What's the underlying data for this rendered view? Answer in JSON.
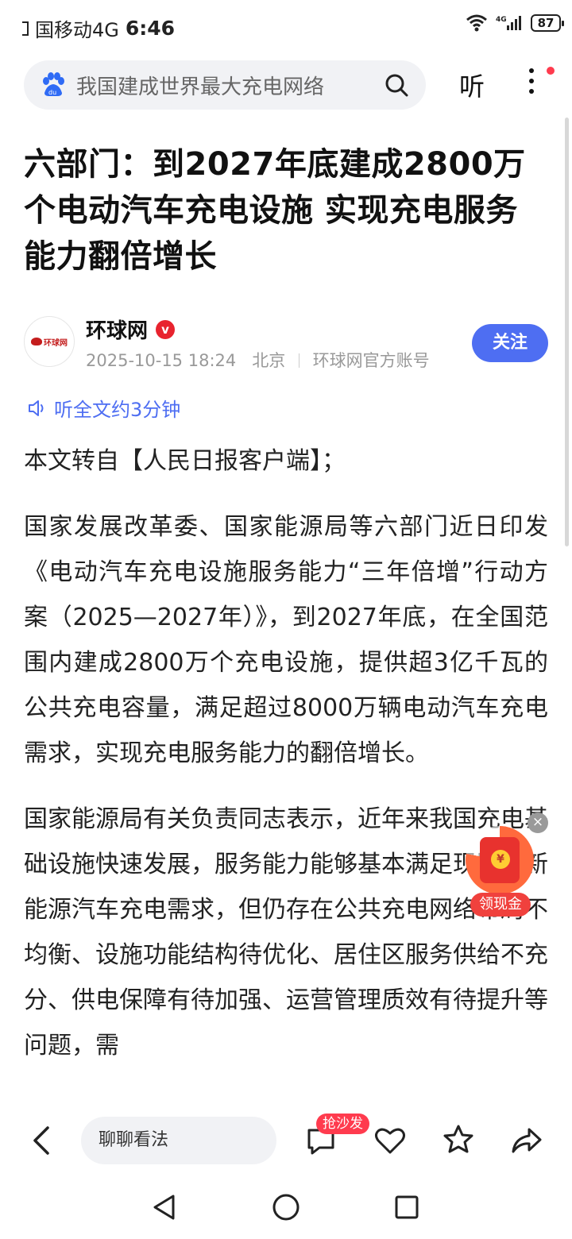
{
  "status_bar": {
    "carrier": "国移动4G",
    "time": "6:46",
    "network": "4G",
    "battery": "87"
  },
  "search": {
    "query": "我国建成世界最大充电网络",
    "listen_label": "听"
  },
  "article": {
    "headline": "六部门：到2027年底建成2800万个电动汽车充电设施 实现充电服务能力翻倍增长",
    "author": {
      "name": "环球网",
      "avatar_text": "环球网",
      "verified_mark": "v",
      "date": "2025-10-15 18:24",
      "location": "北京",
      "account_type": "环球网官方账号",
      "follow_label": "关注"
    },
    "listen_full": "听全文约3分钟",
    "paragraphs": [
      "本文转自【人民日报客户端】；",
      "国家发展改革委、国家能源局等六部门近日印发《电动汽车充电设施服务能力“三年倍增”行动方案（2025—2027年）》，到2027年底，在全国范围内建成2800万个充电设施，提供超3亿千瓦的公共充电容量，满足超过8000万辆电动汽车充电需求，实现充电服务能力的翻倍增长。",
      "国家能源局有关负责同志表示，近年来我国充电基础设施快速发展，服务能力能够基本满足现阶段新能源汽车充电需求，但仍存在公共充电网络布局不均衡、设施功能结构待优化、居住区服务供给不充分、供电保障有待加强、运营管理质效有待提升等问题，需"
    ]
  },
  "float_widget": {
    "coin_symbol": "¥",
    "label": "领现金",
    "close_symbol": "×"
  },
  "action_bar": {
    "comment_placeholder": "聊聊看法",
    "sofa_badge": "抢沙发"
  },
  "colors": {
    "accent": "#4e6ef2",
    "badge_red": "#ff3b4e",
    "search_bg": "#f1f2f5"
  }
}
